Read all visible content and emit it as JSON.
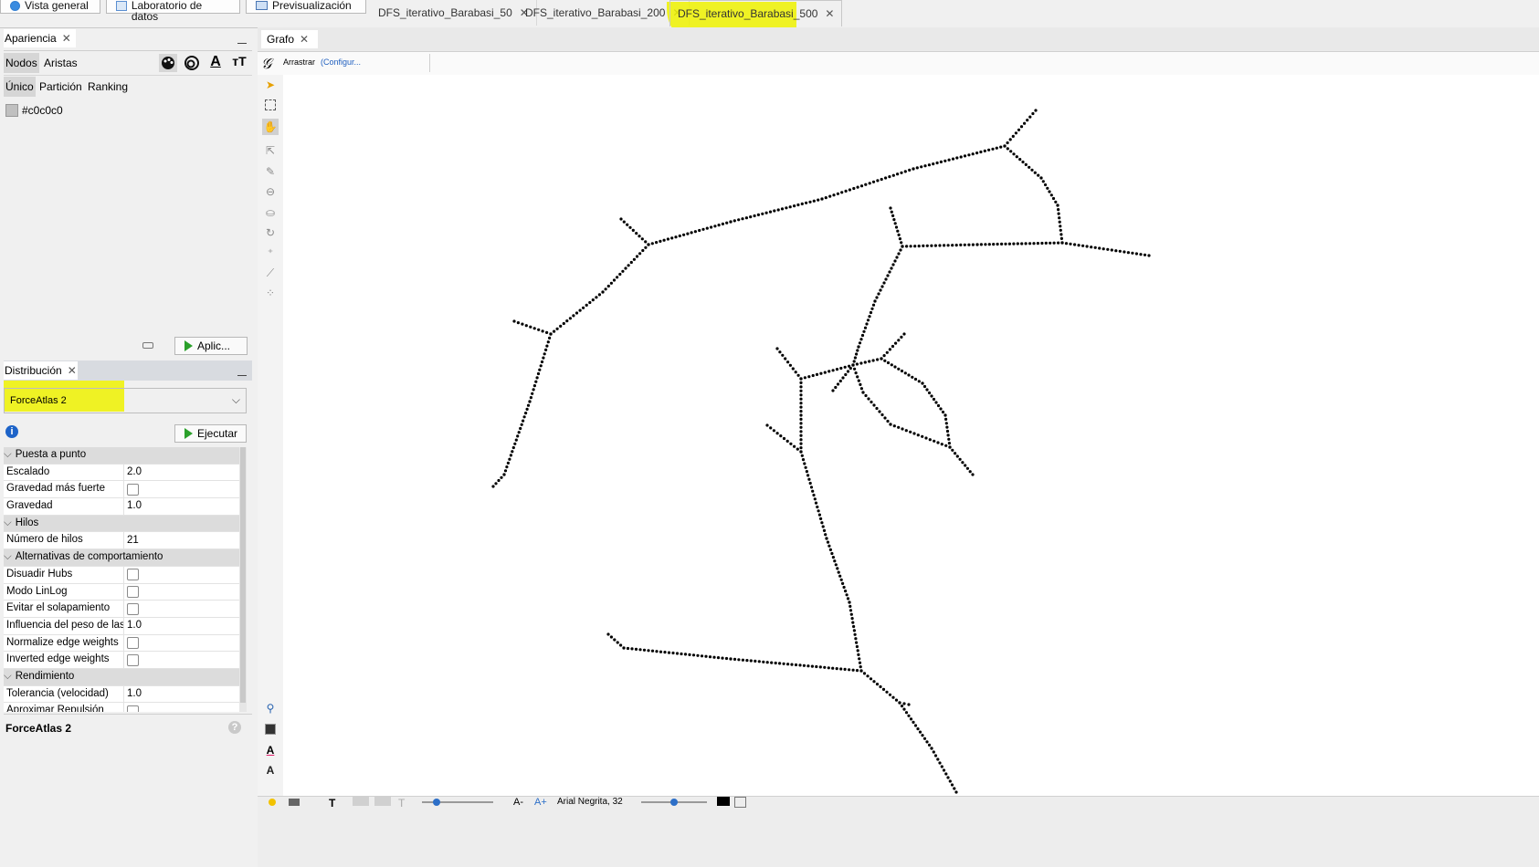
{
  "top_buttons": {
    "overview": "Vista general",
    "data_lab": "Laboratorio de datos",
    "preview": "Previsualización"
  },
  "doc_tabs": [
    {
      "label": "DFS_iterativo_Barabasi_50"
    },
    {
      "label": "DFS_iterativo_Barabasi_200"
    },
    {
      "label": "DFS_iterativo_Barabasi_500"
    }
  ],
  "appearance": {
    "title": "Apariencia",
    "tab_nodes": "Nodos",
    "tab_edges": "Aristas",
    "mode_unique": "Único",
    "mode_partition": "Partición",
    "mode_ranking": "Ranking",
    "color_value": "#c0c0c0",
    "apply_label": "Aplic..."
  },
  "layout": {
    "title": "Distribución",
    "algorithm": "ForceAtlas 2",
    "run_label": "Ejecutar",
    "footer_title": "ForceAtlas 2",
    "properties": [
      {
        "type": "cat",
        "label": "Puesta a punto"
      },
      {
        "type": "val",
        "label": "Escalado",
        "value": "2.0"
      },
      {
        "type": "cb",
        "label": "Gravedad más fuerte"
      },
      {
        "type": "val",
        "label": "Gravedad",
        "value": "1.0"
      },
      {
        "type": "cat",
        "label": "Hilos"
      },
      {
        "type": "val",
        "label": "Número de hilos",
        "value": "21"
      },
      {
        "type": "cat",
        "label": "Alternativas de comportamiento"
      },
      {
        "type": "cb",
        "label": "Disuadir Hubs"
      },
      {
        "type": "cb",
        "label": "Modo LinLog"
      },
      {
        "type": "cb",
        "label": "Evitar el solapamiento"
      },
      {
        "type": "val",
        "label": "Influencia del peso de las",
        "value": "1.0"
      },
      {
        "type": "cb",
        "label": "Normalize edge weights"
      },
      {
        "type": "cb",
        "label": "Inverted edge weights"
      },
      {
        "type": "cat",
        "label": "Rendimiento"
      },
      {
        "type": "val",
        "label": "Tolerancia (velocidad)",
        "value": "1.0"
      },
      {
        "type": "cb",
        "label": "Aproximar Repulsión"
      }
    ]
  },
  "graph": {
    "tab_title": "Grafo",
    "drag_label": "Arrastrar",
    "config_link": "(Configur...",
    "font_label": "Arial Negrita, 32"
  },
  "colors": {
    "highlight": "#eef200",
    "node": "#000000"
  }
}
